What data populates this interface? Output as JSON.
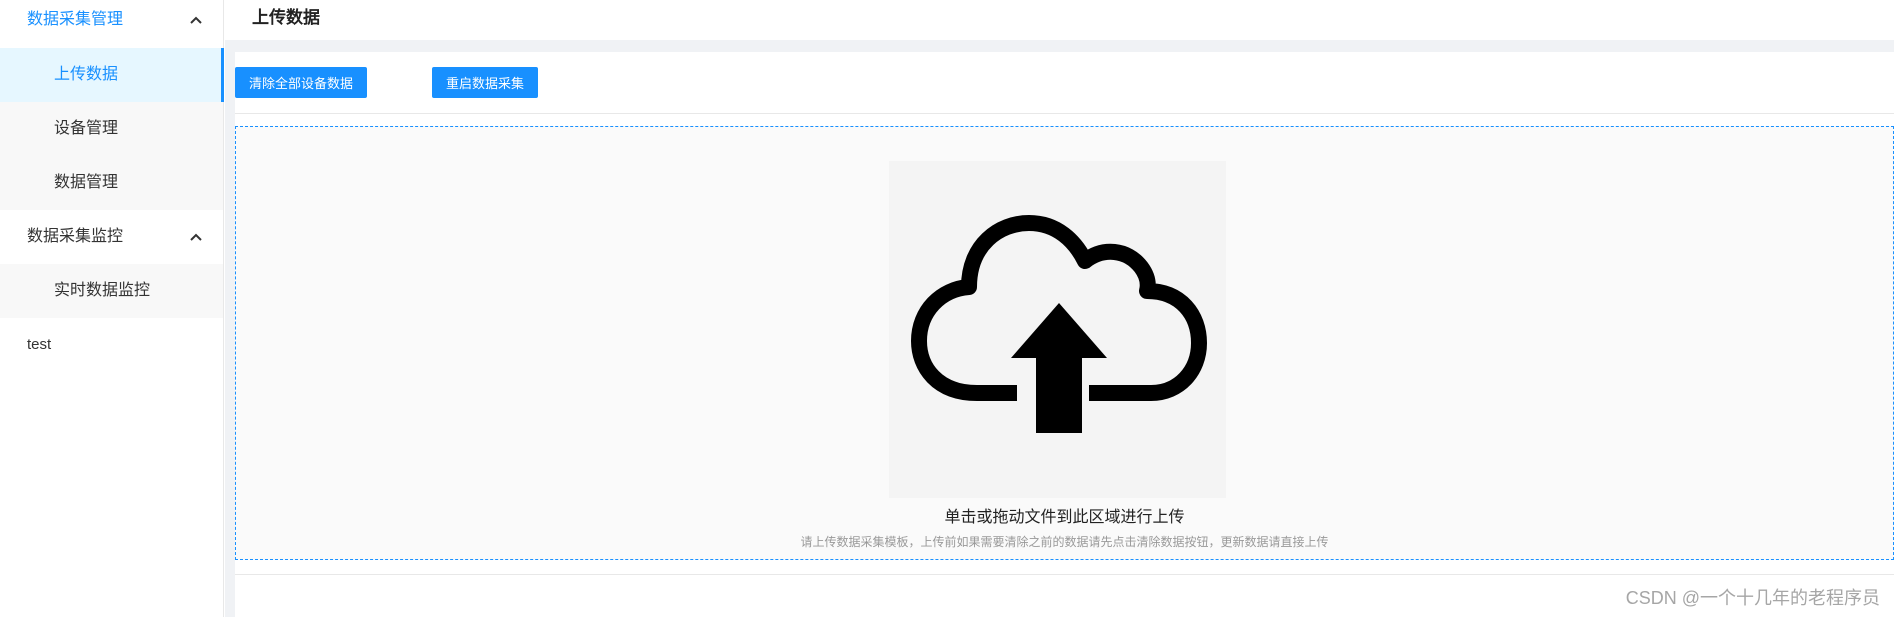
{
  "sidebar": {
    "groups": [
      {
        "label": "数据采集管理",
        "expanded": true,
        "items": [
          {
            "label": "上传数据",
            "selected": true
          },
          {
            "label": "设备管理",
            "selected": false
          },
          {
            "label": "数据管理",
            "selected": false
          }
        ]
      },
      {
        "label": "数据采集监控",
        "expanded": true,
        "items": [
          {
            "label": "实时数据监控",
            "selected": false
          }
        ]
      }
    ],
    "extra_item": "test"
  },
  "page": {
    "title": "上传数据"
  },
  "toolbar": {
    "clear_all_label": "清除全部设备数据",
    "restart_label": "重启数据采集"
  },
  "upload": {
    "icon": "cloud-upload-icon",
    "main_text": "单击或拖动文件到此区域进行上传",
    "hint_text": "请上传数据采集模板，上传前如果需要清除之前的数据请先点击清除数据按钮，更新数据请直接上传"
  },
  "watermark": "CSDN @一个十几年的老程序员",
  "colors": {
    "accent": "#1890ff",
    "selected_bg": "#e6f7ff",
    "hint": "#999999"
  }
}
